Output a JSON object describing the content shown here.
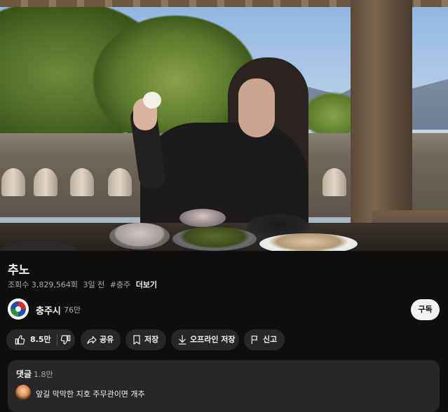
{
  "video": {
    "title": "추노",
    "views": "조회수 3,829,564회",
    "age": "3일 전",
    "hashtag": "#충주",
    "more_label": "더보기"
  },
  "channel": {
    "name": "충주시",
    "subscribers": "76만",
    "subscribe_label": "구독"
  },
  "actions": {
    "like_count": "8.5만",
    "share_label": "공유",
    "save_label": "저장",
    "offline_label": "오프라인 저장",
    "report_label": "신고"
  },
  "comments": {
    "header": "댓글",
    "count": "1.8만",
    "top_comment": "앞길 막막한 지호 주무관이면 개추"
  },
  "icons": {
    "like": "thumbs-up-icon",
    "dislike": "thumbs-down-icon",
    "share": "share-arrow-icon",
    "save": "bookmark-icon",
    "offline": "download-icon",
    "report": "flag-icon"
  },
  "colors": {
    "background": "#0f0f0f",
    "pill": "#272727",
    "text": "#f1f1f1",
    "secondary_text": "#aaaaaa",
    "subscribe_button": "#f1f1f1"
  }
}
